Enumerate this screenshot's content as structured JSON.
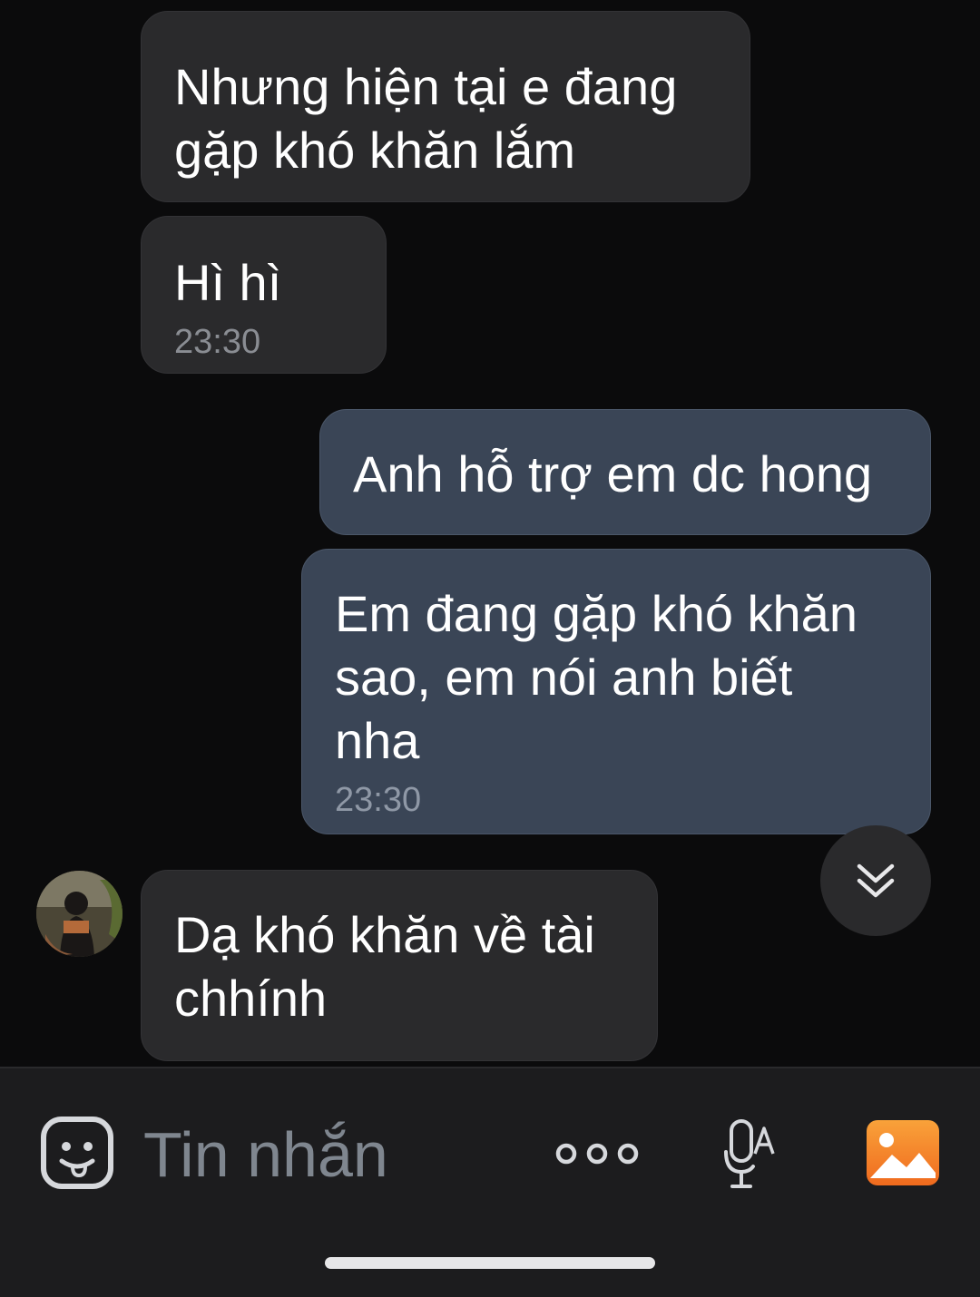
{
  "messages": [
    {
      "direction": "in",
      "text": "Nhưng hiện tại e đang\ngặp khó khăn lắm",
      "time": ""
    },
    {
      "direction": "in",
      "text": "Hì hì",
      "time": "23:30"
    },
    {
      "direction": "out",
      "text": "Anh hỗ trợ em dc hong",
      "time": ""
    },
    {
      "direction": "out",
      "text": "Em đang gặp khó khăn\nsao, em nói anh biết\nnha",
      "time": "23:30"
    },
    {
      "direction": "in",
      "text": "Dạ khó khăn về tài\nchhính",
      "time": ""
    }
  ],
  "composer": {
    "placeholder": "Tin nhắn",
    "emoji_icon": "sticker-face-icon",
    "more_icon": "more-dots-icon",
    "voice_icon": "voice-to-text-icon",
    "photo_icon": "photo-gallery-icon"
  },
  "scroll_button": {
    "icon": "double-chevron-down-icon"
  },
  "colors": {
    "background": "#0b0b0c",
    "incoming_bubble": "#2a2a2c",
    "outgoing_bubble": "#3a4556",
    "accent_photo": "#f07a2a"
  }
}
